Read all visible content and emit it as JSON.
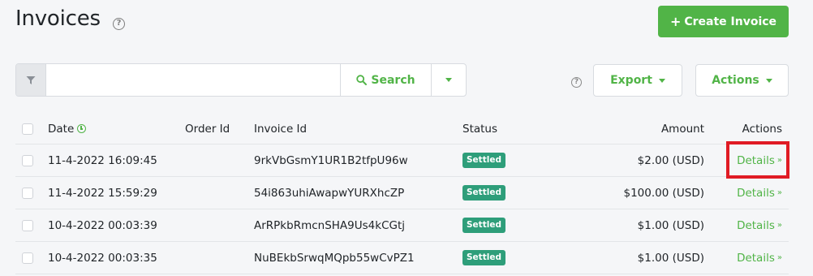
{
  "header": {
    "title": "Invoices",
    "help_glyph": "?",
    "create_label": "Create Invoice"
  },
  "toolbar": {
    "search_placeholder": "",
    "search_label": "Search",
    "help_glyph": "?",
    "export_label": "Export",
    "actions_label": "Actions"
  },
  "table": {
    "columns": {
      "date": "Date",
      "order_id": "Order Id",
      "invoice_id": "Invoice Id",
      "status": "Status",
      "amount": "Amount",
      "actions": "Actions"
    },
    "rows": [
      {
        "date": "11-4-2022 16:09:45",
        "order_id": "",
        "invoice_id": "9rkVbGsmY1UR1B2tfpU96w",
        "status": "Settled",
        "amount": "$2.00 (USD)",
        "action": "Details"
      },
      {
        "date": "11-4-2022 15:59:29",
        "order_id": "",
        "invoice_id": "54i863uhiAwapwYURXhcZP",
        "status": "Settled",
        "amount": "$100.00 (USD)",
        "action": "Details"
      },
      {
        "date": "10-4-2022 00:03:39",
        "order_id": "",
        "invoice_id": "ArRPkbRmcnSHA9Us4kCGtj",
        "status": "Settled",
        "amount": "$1.00 (USD)",
        "action": "Details"
      },
      {
        "date": "10-4-2022 00:03:35",
        "order_id": "",
        "invoice_id": "NuBEkbSrwqMQpb55wCvPZ1",
        "status": "Settled",
        "amount": "$1.00 (USD)",
        "action": "Details"
      }
    ]
  },
  "colors": {
    "accent": "#51b447",
    "status_settled": "#2e9e7a",
    "highlight": "#e01b24"
  },
  "icons": {
    "filter": "filter-icon",
    "search": "search-icon",
    "clock": "clock-icon",
    "chevron": "chevron-double-down-icon"
  }
}
